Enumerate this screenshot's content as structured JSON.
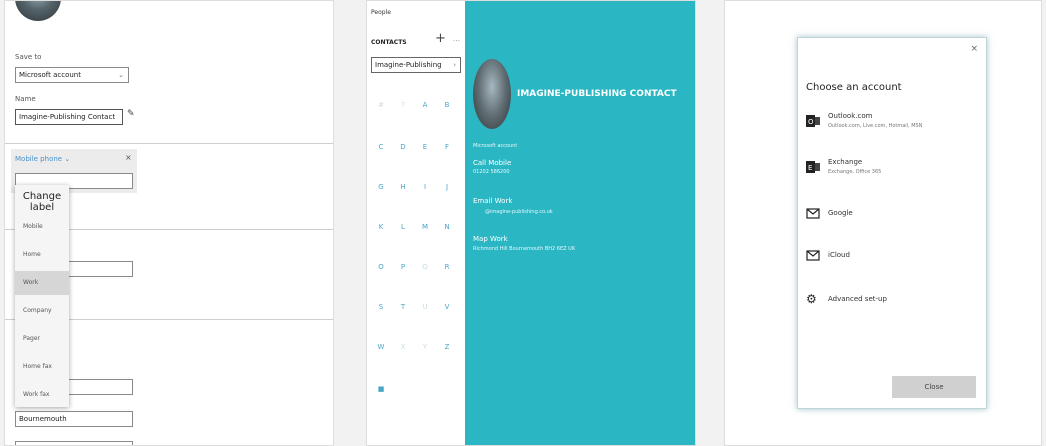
{
  "panel1": {
    "save_to_label": "Save to",
    "save_to_value": "Microsoft account",
    "name_label": "Name",
    "name_value": "Imagine-Publishing Contact",
    "phone_label": "Mobile phone",
    "menu_title": "Change label",
    "menu_items": [
      "Mobile",
      "Home",
      "Work",
      "Company",
      "Pager",
      "Home fax",
      "Work fax"
    ],
    "selected_menu_item": "Work",
    "address_value": "Bournemouth"
  },
  "panel2": {
    "app_title": "People",
    "contacts_label": "CONTACTS",
    "add_icon": "+",
    "more_icon": "…",
    "search_value": "Imagine-Publishing",
    "letters": [
      [
        "#",
        "?",
        "A",
        "B"
      ],
      [
        "C",
        "D",
        "E",
        "F"
      ],
      [
        "G",
        "H",
        "I",
        "J"
      ],
      [
        "K",
        "L",
        "M",
        "N"
      ],
      [
        "O",
        "P",
        "Q",
        "R"
      ],
      [
        "S",
        "T",
        "U",
        "V"
      ],
      [
        "W",
        "X",
        "Y",
        "Z"
      ],
      [
        "■"
      ]
    ],
    "contact_name": "IMAGINE-PUBLISHING CONTACT",
    "account": "Microsoft account",
    "call_label": "Call Mobile",
    "call_value": "01202 586200",
    "email_label": "Email Work",
    "email_value": "@imagine-publishing.co.uk",
    "map_label": "Map Work",
    "map_value": "Richmond Hill Bournemouth BH2 6EZ UK",
    "teal_color": "#2bb6c4"
  },
  "panel3": {
    "close_x": "×",
    "title": "Choose an account",
    "accounts": [
      {
        "name": "Outlook.com",
        "sub": "Outlook.com, Live.com, Hotmail, MSN",
        "icon": "outlook-icon"
      },
      {
        "name": "Exchange",
        "sub": "Exchange, Office 365",
        "icon": "exchange-icon"
      },
      {
        "name": "Google",
        "sub": "",
        "icon": "mail-icon"
      },
      {
        "name": "iCloud",
        "sub": "",
        "icon": "mail-icon"
      },
      {
        "name": "Advanced set-up",
        "sub": "",
        "icon": "gear-icon"
      }
    ],
    "close_button": "Close"
  }
}
